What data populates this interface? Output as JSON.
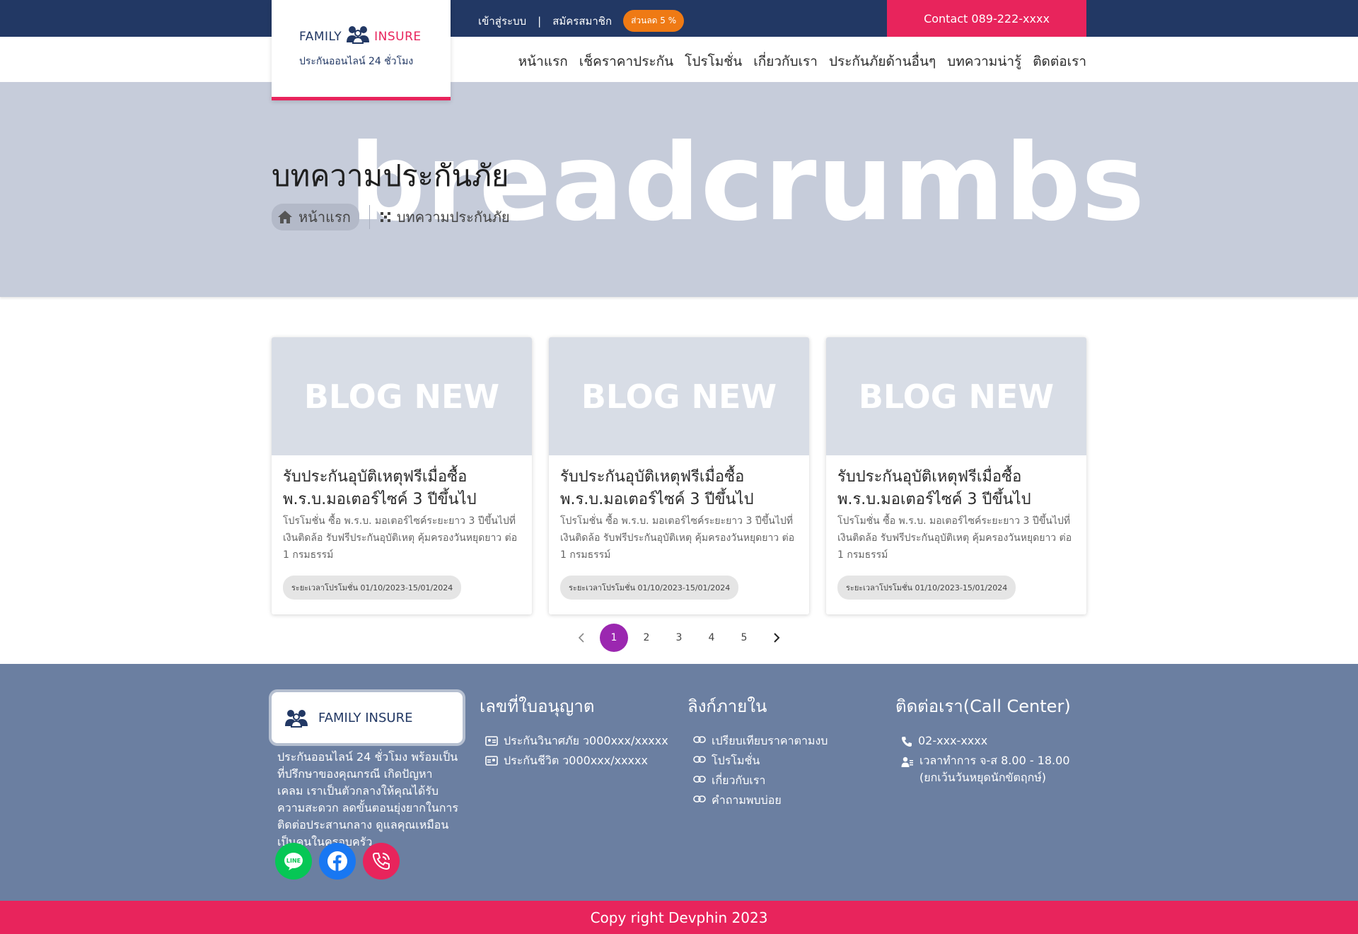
{
  "brand": {
    "name_family": "FAMILY",
    "name_insure": "INSURE",
    "tagline": "ประกันออนไลน์ 24 ชั่วโมง"
  },
  "topbar": {
    "login": "เข้าสู่ระบบ",
    "separator": "|",
    "register": "สมัครสมาชิก",
    "discount_badge": "ส่วนลด 5 %",
    "contact": "Contact 089-222-xxxx"
  },
  "nav": {
    "items": [
      "หน้าแรก",
      "เช็คราคาประกัน",
      "โปรโมชั่น",
      "เกี่ยวกับเรา",
      "ประกันภัยด้านอื่นๆ",
      "บทความน่ารู้",
      "ติดต่อเรา"
    ]
  },
  "hero": {
    "watermark": "breadcrumbs",
    "title": "บทความประกันภัย",
    "breadcrumb_home": "หน้าแรก",
    "breadcrumb_current": "บทความประกันภัย"
  },
  "cards": [
    {
      "image_text": "BLOG NEW",
      "title": "รับประกันอุบัติเหตุฟรีเมื่อซื้อ พ.ร.บ.มอเตอร์ไซค์ 3 ปีขึ้นไป",
      "description": "โปรโมชั่น ซื้อ พ.ร.บ. มอเตอร์ไซค์ระยะยาว 3 ปีขึ้นไปที่เงินติดล้อ รับฟรีประกันอุบัติเหตุ คุ้มครองวันหยุดยาว ต่อ 1 กรมธรรม์",
      "period": "ระยะเวลาโปรโมชั่น 01/10/2023-15/01/2024"
    },
    {
      "image_text": "BLOG NEW",
      "title": "รับประกันอุบัติเหตุฟรีเมื่อซื้อ พ.ร.บ.มอเตอร์ไซค์ 3 ปีขึ้นไป",
      "description": "โปรโมชั่น ซื้อ พ.ร.บ. มอเตอร์ไซค์ระยะยาว 3 ปีขึ้นไปที่เงินติดล้อ รับฟรีประกันอุบัติเหตุ คุ้มครองวันหยุดยาว ต่อ 1 กรมธรรม์",
      "period": "ระยะเวลาโปรโมชั่น 01/10/2023-15/01/2024"
    },
    {
      "image_text": "BLOG NEW",
      "title": "รับประกันอุบัติเหตุฟรีเมื่อซื้อ พ.ร.บ.มอเตอร์ไซค์ 3 ปีขึ้นไป",
      "description": "โปรโมชั่น ซื้อ พ.ร.บ. มอเตอร์ไซค์ระยะยาว 3 ปีขึ้นไปที่เงินติดล้อ รับฟรีประกันอุบัติเหตุ คุ้มครองวันหยุดยาว ต่อ 1 กรมธรรม์",
      "period": "ระยะเวลาโปรโมชั่น 01/10/2023-15/01/2024"
    }
  ],
  "pagination": {
    "pages": [
      "1",
      "2",
      "3",
      "4",
      "5"
    ],
    "current": "1"
  },
  "footer": {
    "logo_text": "FAMILY INSURE",
    "about": "ประกันออนไลน์ 24 ชั่วโมง พร้อมเป็นที่ปรึกษาของคุณกรณี เกิดปัญหา เคลม เราเป็นตัวกลางให้คุณได้รับความสะดวก ลดขั้นตอนยุ่งยากในการติดต่อประสานกลาง ดูแลคุณเหมือนเป็นคนในครอบครัว",
    "license": {
      "heading": "เลขที่ใบอนุญาต",
      "items": [
        "ประกันวินาศภัย ว000xxx/xxxxx",
        "ประกันชีวิต ว000xxx/xxxxx"
      ]
    },
    "links": {
      "heading": "ลิงก์ภายใน",
      "items": [
        "เปรียบเทียบราคาตามงบ",
        "โปรโมชั่น",
        "เกี่ยวกับเรา",
        "คำถามพบบ่อย"
      ]
    },
    "contact": {
      "heading": "ติดต่อเรา(Call Center)",
      "phone": "02-xxx-xxxx",
      "hours": "เวลาทำการ จ-ส 8.00 - 18.00",
      "hours_note": "(ยกเว้นวันหยุดนักขัตฤกษ์)"
    },
    "copyright": "Copy right Devphin 2023"
  },
  "colors": {
    "navy": "#223864",
    "pink": "#e8245c",
    "orange": "#ef7a14",
    "hero_bg": "#c6ccda",
    "footer_bg": "#6b7fa1",
    "pager_active": "#9b27b0",
    "line_green": "#06c755",
    "facebook_blue": "#1877f2"
  },
  "icons": [
    "family-icon",
    "home-icon",
    "grid-icon",
    "chevron-left-icon",
    "chevron-right-icon",
    "id-card-icon",
    "link-icon",
    "phone-icon",
    "user-clock-icon",
    "line-icon",
    "facebook-icon",
    "phone-call-icon"
  ]
}
